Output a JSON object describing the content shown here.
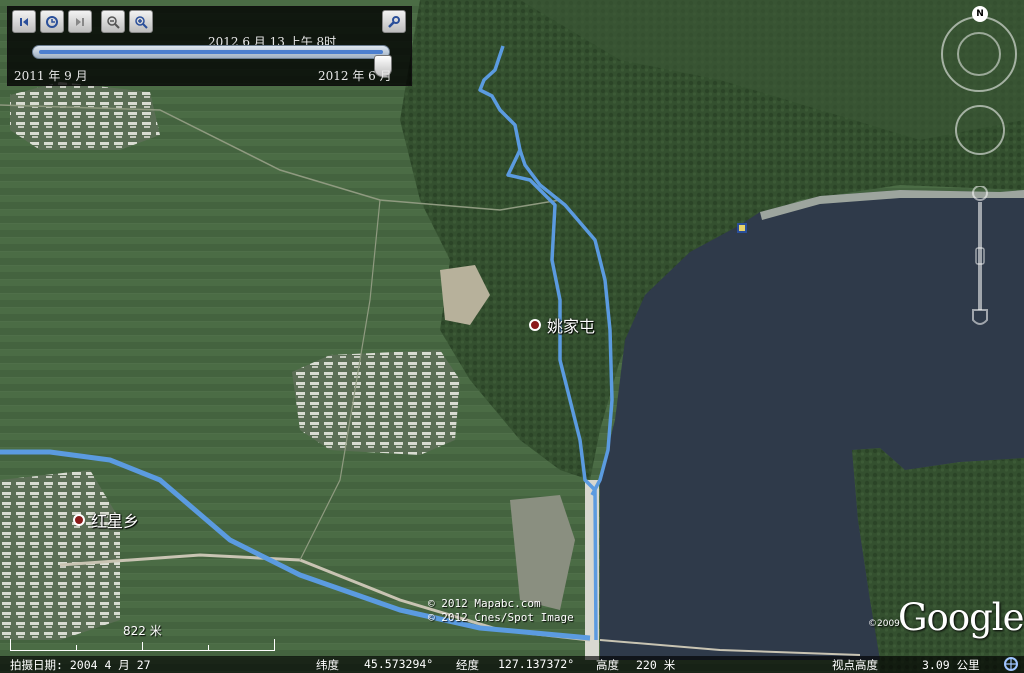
{
  "time_slider": {
    "current_time": "2012 6 月 13  上午   8时",
    "start_label": "2011 年 9 月",
    "end_label": "2012 年 6 月",
    "position_fraction": 0.98
  },
  "controls": {
    "back_icon": "skip-back-icon",
    "animate_icon": "clock-animate-icon",
    "forward_icon": "skip-forward-icon",
    "zoom_out_icon": "zoom-out-icon",
    "zoom_in_icon": "zoom-in-icon",
    "options_icon": "wrench-icon"
  },
  "navigation": {
    "north_label": "N"
  },
  "places": [
    {
      "name": "姚家屯"
    },
    {
      "name": "红星乡"
    }
  ],
  "copyright": [
    "© 2012 Mapabc.com",
    "© 2012 Cnes/Spot Image"
  ],
  "logo": {
    "text": "Google",
    "year": "©2009"
  },
  "scale": {
    "label": "822 米"
  },
  "status": {
    "imagery_date": "拍摄日期: 2004 4 月 27",
    "lat_label": "纬度",
    "lat_value": "45.573294°",
    "lon_label": "经度",
    "lon_value": "127.137372°",
    "elev_label": "高度",
    "elev_value": "220 米",
    "eye_label": "视点高度",
    "eye_value": "3.09 公里"
  },
  "colors": {
    "track": "#5b9be0",
    "lake": "#2f3a4a",
    "place_dot": "#8b1a1a"
  }
}
